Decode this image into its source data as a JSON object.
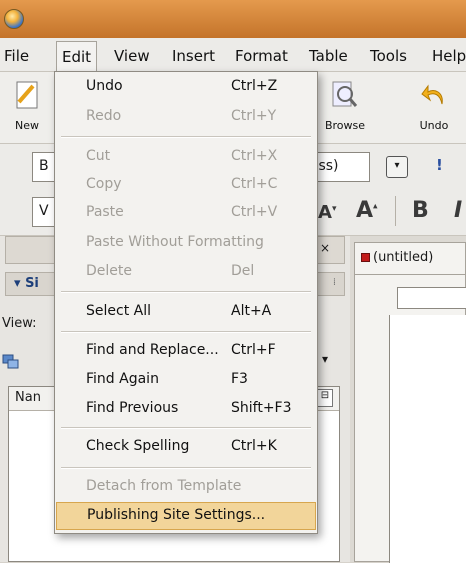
{
  "menubar": {
    "items": [
      "File",
      "Edit",
      "View",
      "Insert",
      "Format",
      "Table",
      "Tools",
      "Help"
    ],
    "active": "Edit"
  },
  "toolbar": {
    "new_label": "New",
    "browse_label": "Browse",
    "undo_label": "Undo"
  },
  "format_row": {
    "paragraph_value": "B",
    "class_value": "lass)",
    "exclaim": "!"
  },
  "font_row": {
    "font_value": "V",
    "smaller_label": "A",
    "larger_label": "A",
    "bold_label": "B",
    "italic_label": "I"
  },
  "site_panel": {
    "title": "Si",
    "view_label": "View:",
    "name_header": "Nan"
  },
  "document": {
    "tab_label": "(untitled)"
  },
  "edit_menu": {
    "undo": {
      "label": "Undo",
      "shortcut": "Ctrl+Z"
    },
    "redo": {
      "label": "Redo",
      "shortcut": "Ctrl+Y"
    },
    "cut": {
      "label": "Cut",
      "shortcut": "Ctrl+X"
    },
    "copy": {
      "label": "Copy",
      "shortcut": "Ctrl+C"
    },
    "paste": {
      "label": "Paste",
      "shortcut": "Ctrl+V"
    },
    "paste_without_formatting": {
      "label": "Paste Without Formatting"
    },
    "delete": {
      "label": "Delete",
      "shortcut": "Del"
    },
    "select_all": {
      "label": "Select All",
      "shortcut": "Alt+A"
    },
    "find_replace": {
      "label": "Find and Replace...",
      "shortcut": "Ctrl+F"
    },
    "find_again": {
      "label": "Find Again",
      "shortcut": "F3"
    },
    "find_previous": {
      "label": "Find Previous",
      "shortcut": "Shift+F3"
    },
    "check_spelling": {
      "label": "Check Spelling",
      "shortcut": "Ctrl+K"
    },
    "detach_template": {
      "label": "Detach from Template"
    },
    "publishing_settings": {
      "label": "Publishing Site Settings..."
    }
  },
  "colors": {
    "titlebar": "#d88a3e",
    "menu_highlight": "#f2d59a",
    "disabled_text": "#a19e98"
  }
}
